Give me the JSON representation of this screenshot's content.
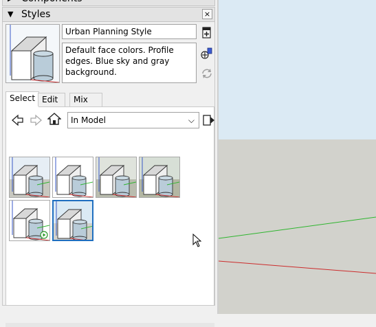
{
  "components_header": {
    "title": "Components"
  },
  "styles_header": {
    "title": "Styles",
    "close": "×",
    "collapse": "▼"
  },
  "style": {
    "name": "Urban Planning Style",
    "description": "Default face colors.  Profile\nedges. Blue sky and gray\nbackground."
  },
  "tabs": [
    {
      "label": "Select",
      "active": true
    },
    {
      "label": "Edit",
      "active": false
    },
    {
      "label": "Mix",
      "active": false
    }
  ],
  "collection": {
    "selected": "In Model",
    "chevron": "⌵"
  },
  "icons": {
    "create_style": "create-style-icon",
    "update_style": "update-style-icon",
    "refresh": "refresh-icon",
    "back": "back-arrow-icon",
    "forward": "forward-arrow-icon",
    "home": "home-icon",
    "details": "details-flyout-icon"
  },
  "thumbnails": [
    {
      "id": "style-1",
      "bg": "#e6eef5",
      "ground": "#c8c8c0"
    },
    {
      "id": "style-2",
      "bg": "#ffffff",
      "ground": "#ffffff"
    },
    {
      "id": "style-3",
      "bg": "#dfe3dc",
      "ground": "#b9bcae"
    },
    {
      "id": "style-4",
      "bg": "#d7dfd6",
      "ground": "#b3b7a3"
    },
    {
      "id": "style-5",
      "bg": "#ffffff",
      "ground": "#ffffff"
    },
    {
      "id": "style-6",
      "bg": "#dbeaf4",
      "ground": "#d2d2cc"
    }
  ],
  "selected_thumbnail": "style-6",
  "colors": {
    "selection": "#1f6fc0",
    "green_axis": "#2db52d",
    "red_axis": "#cc2a2a",
    "sky": "#dbeaf4",
    "ground": "#d2d2cc"
  }
}
